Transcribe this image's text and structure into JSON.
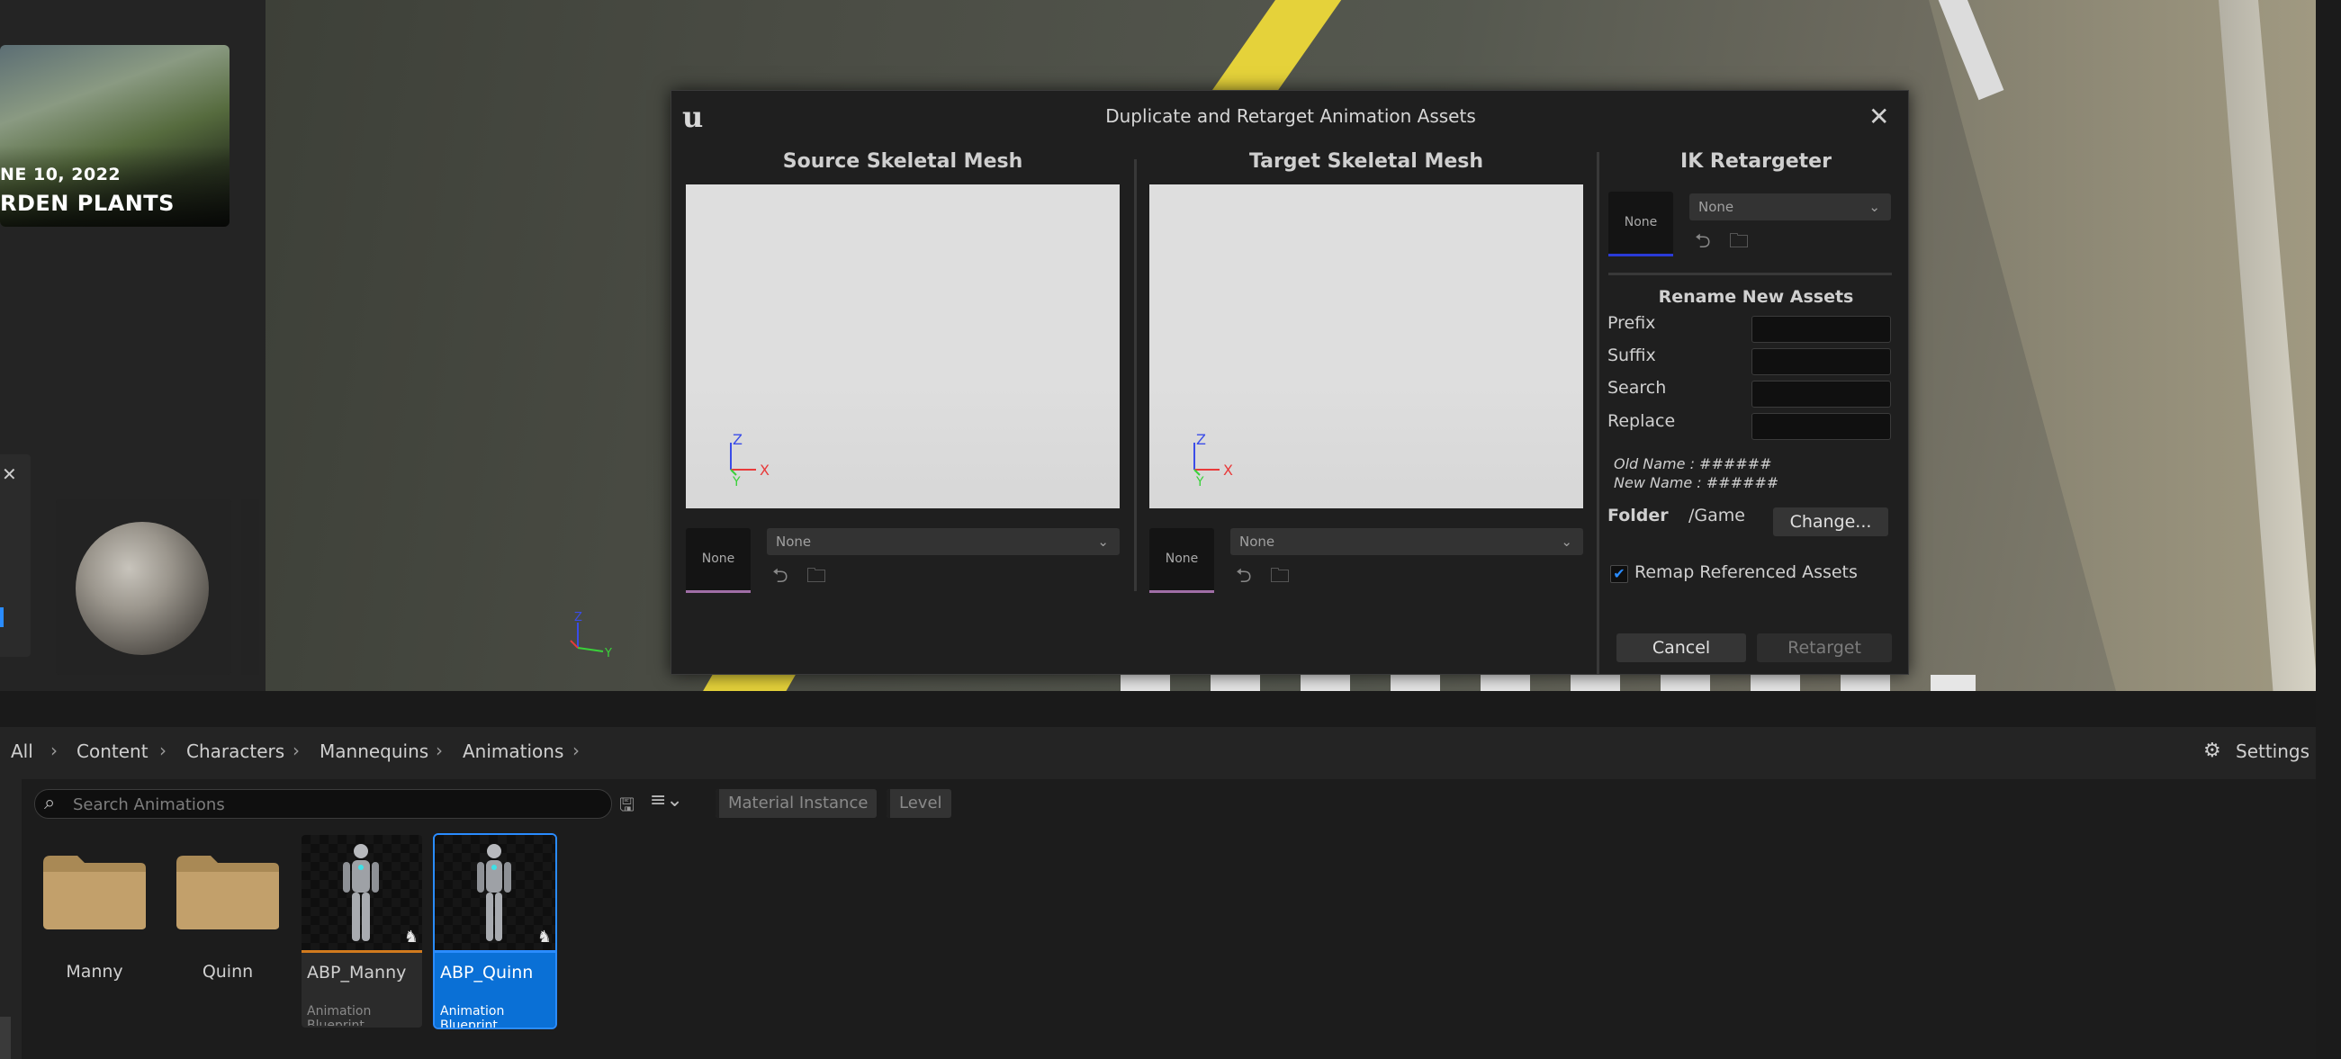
{
  "left_panel": {
    "thumb_date": "NE 10, 2022",
    "thumb_title": "RDEN PLANTS"
  },
  "dialog": {
    "title": "Duplicate and Retarget Animation Assets",
    "source": {
      "title": "Source Skeletal Mesh",
      "thumb_label": "None",
      "combo_value": "None",
      "axes": {
        "z": "Z",
        "x": "X",
        "y": "Y"
      }
    },
    "target": {
      "title": "Target Skeletal Mesh",
      "thumb_label": "None",
      "combo_value": "None",
      "axes": {
        "z": "Z",
        "x": "X",
        "y": "Y"
      }
    },
    "ik": {
      "title": "IK Retargeter",
      "thumb_label": "None",
      "combo_value": "None"
    },
    "rename": {
      "title": "Rename New Assets",
      "prefix_label": "Prefix",
      "suffix_label": "Suffix",
      "search_label": "Search",
      "replace_label": "Replace",
      "old_name": "Old Name : ######",
      "new_name": "New Name : ######"
    },
    "folder": {
      "label": "Folder",
      "path": "/Game",
      "change_button": "Change..."
    },
    "remap_label": "Remap Referenced Assets",
    "remap_checked": true,
    "cancel_button": "Cancel",
    "retarget_button": "Retarget"
  },
  "viewport": {
    "gizmo": {
      "z": "Z",
      "y": "Y"
    }
  },
  "content_browser": {
    "breadcrumb": [
      "All",
      "Content",
      "Characters",
      "Mannequins",
      "Animations"
    ],
    "settings_label": "Settings",
    "search_placeholder": "Search Animations",
    "filter_chips": [
      "Material Instance",
      "Level"
    ],
    "folders": [
      "Manny",
      "Quinn"
    ],
    "assets": [
      {
        "name": "ABP_Manny",
        "type": "Animation Blueprint",
        "selected": false
      },
      {
        "name": "ABP_Quinn",
        "type": "Animation Blueprint",
        "selected": true
      }
    ]
  },
  "colors": {
    "accent_blue": "#0a70d6",
    "selection_blue": "#2a8cff",
    "folder_tan": "#c2a06b",
    "axis_x": "#e83a3a",
    "axis_y": "#3ad13a",
    "axis_z": "#3a4ce8"
  }
}
